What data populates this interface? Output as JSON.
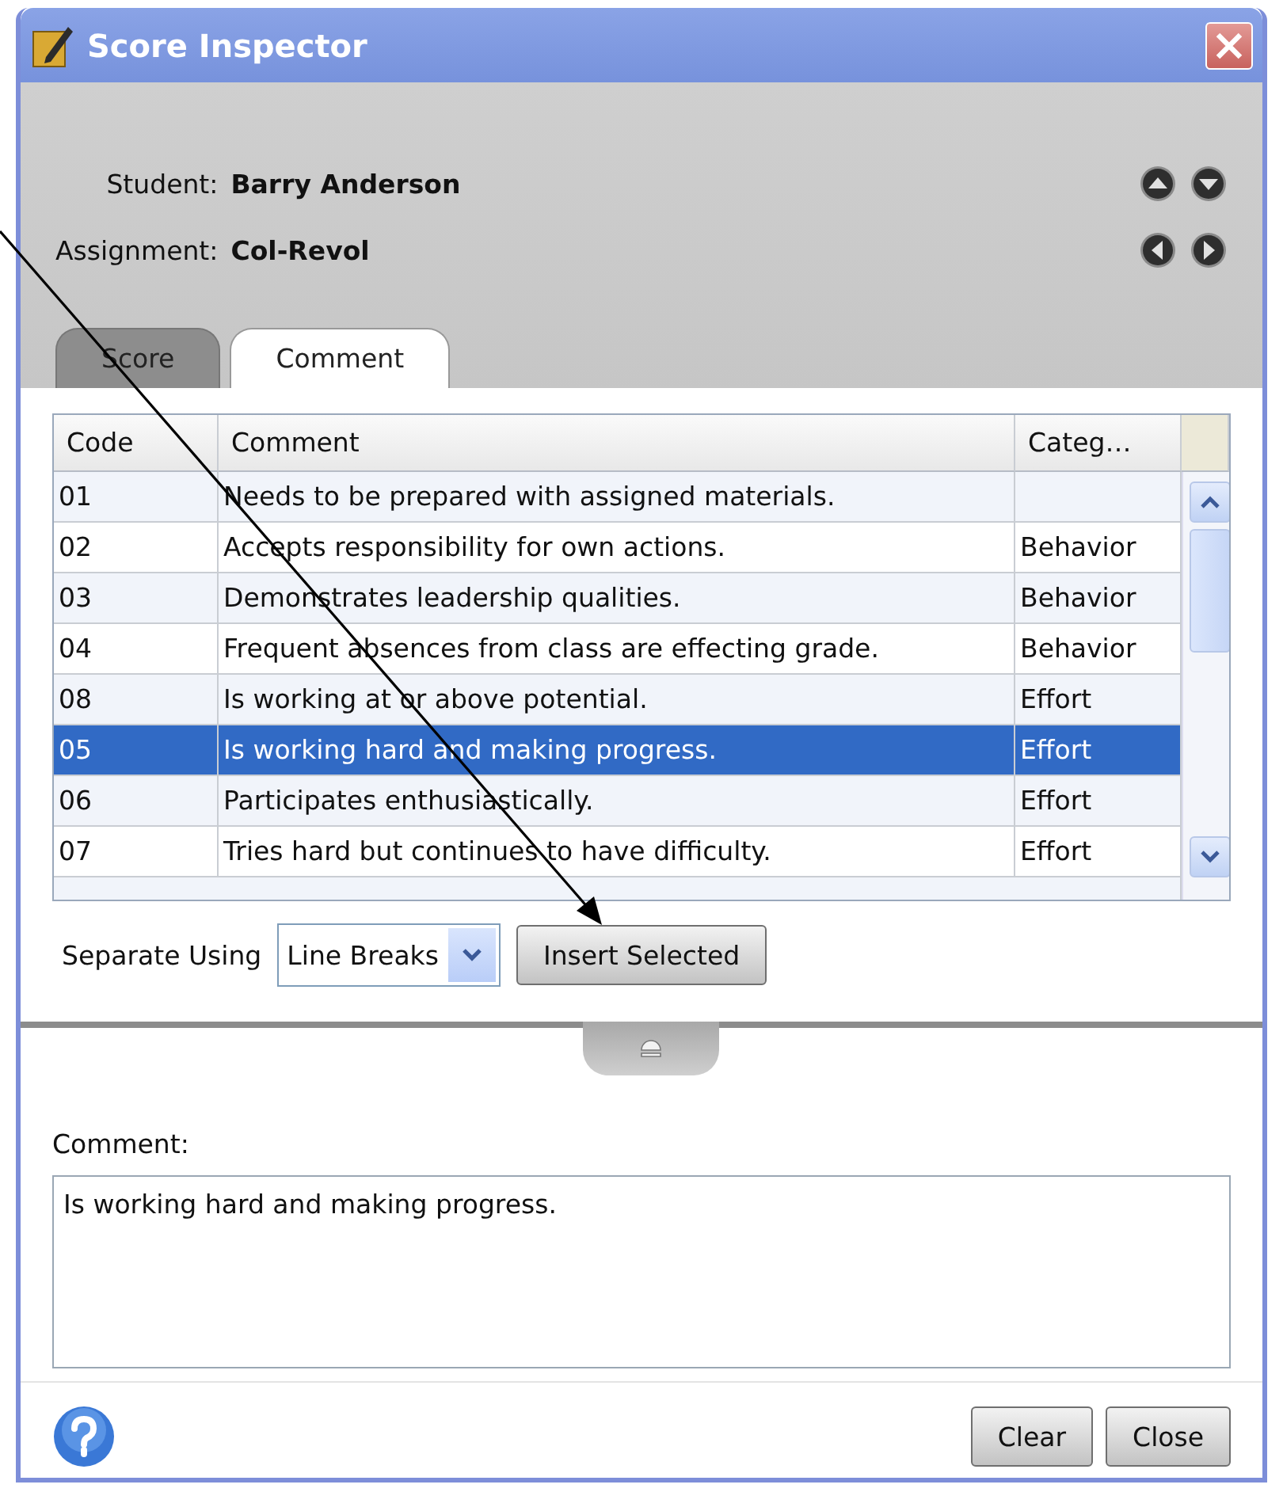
{
  "window": {
    "title": "Score Inspector"
  },
  "student": {
    "label": "Student:",
    "value": "Barry Anderson"
  },
  "assignment": {
    "label": "Assignment:",
    "value": "Col-Revol"
  },
  "tabs": [
    {
      "label": "Score",
      "selected": false
    },
    {
      "label": "Comment",
      "selected": true
    }
  ],
  "table": {
    "columns": [
      "Code",
      "Comment",
      "Categ…"
    ],
    "rows": [
      {
        "code": "01",
        "comment": "Needs to be prepared with assigned materials.",
        "selected": false
      },
      {
        "code": "02",
        "comment": "Accepts responsibility for own actions.",
        "category": "Behavior",
        "selected": false
      },
      {
        "code": "03",
        "comment": "Demonstrates leadership qualities.",
        "category": "Behavior",
        "selected": false
      },
      {
        "code": "04",
        "comment": "Frequent absences from class are effecting grade.",
        "category": "Behavior",
        "selected": false
      },
      {
        "code": "08",
        "comment": "Is working at or above potential.",
        "category": "Effort",
        "selected": false
      },
      {
        "code": "05",
        "comment": "Is working hard and making progress.",
        "category": "Effort",
        "selected": true
      },
      {
        "code": "06",
        "comment": "Participates enthusiastically.",
        "category": "Effort",
        "selected": false
      },
      {
        "code": "07",
        "comment": "Tries hard but continues to have difficulty.",
        "category": "Effort",
        "selected": false
      }
    ]
  },
  "separate": {
    "label": "Separate Using",
    "value": "Line Breaks"
  },
  "insert_button": "Insert Selected",
  "comment": {
    "label": "Comment:",
    "value": "Is working hard and making progress."
  },
  "buttons": [
    "Clear",
    "Close"
  ]
}
